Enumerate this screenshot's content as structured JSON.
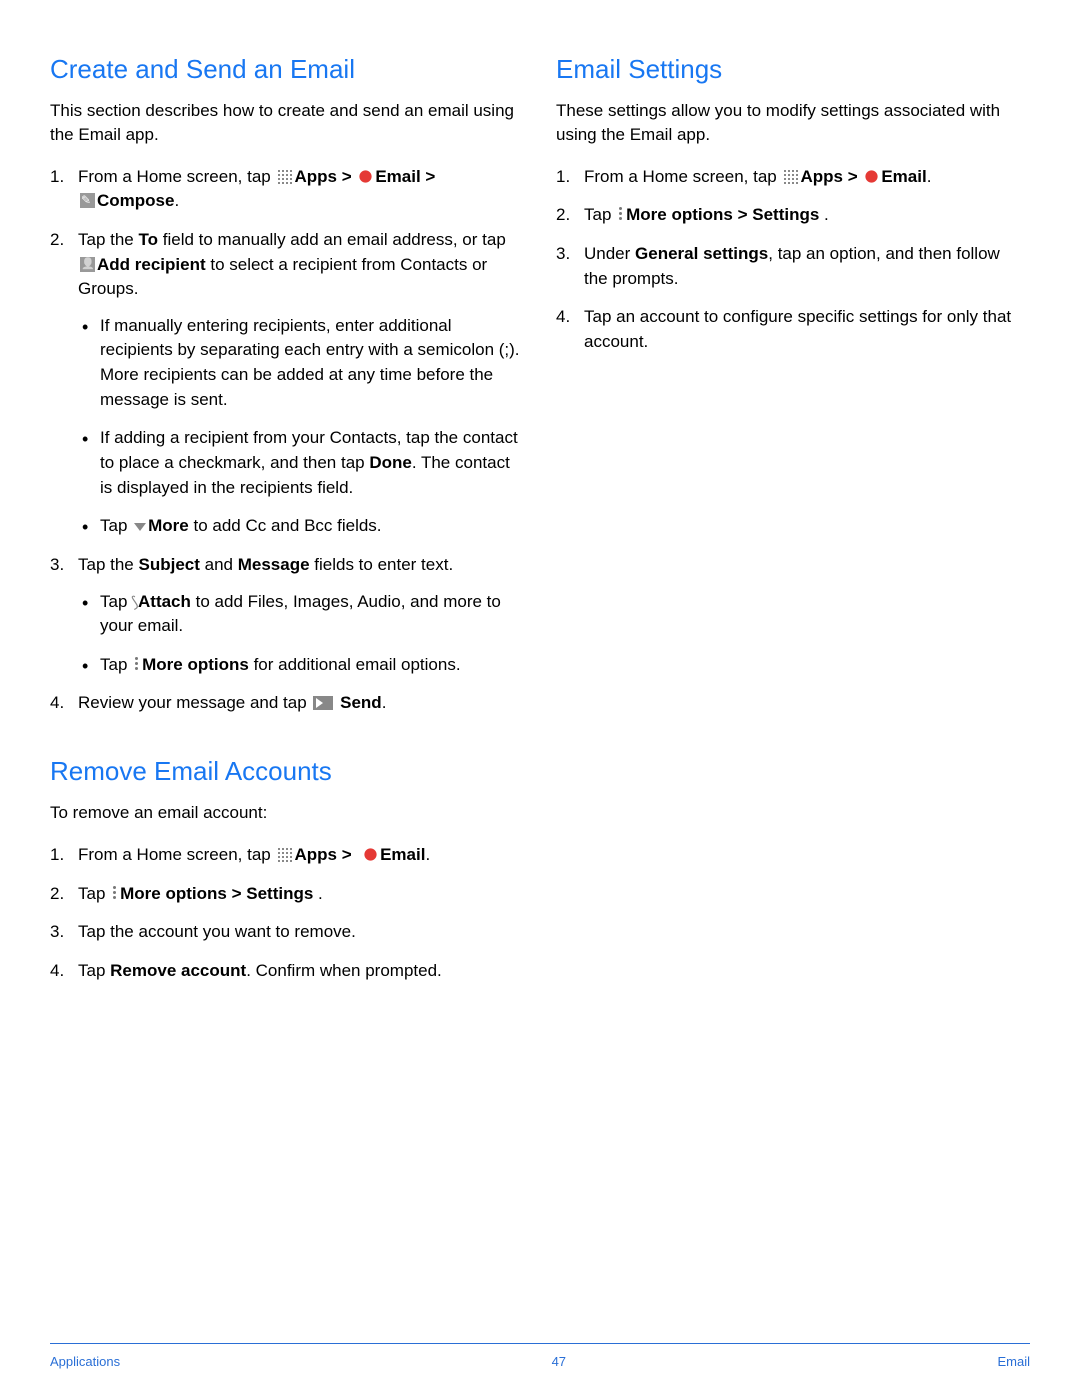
{
  "left": {
    "h1": "Create and Send an Email",
    "intro": "This section describes how to create and send an email using the Email app.",
    "s1_a": "From a Home screen, tap ",
    "apps": "Apps",
    "gt": " > ",
    "email": "Email",
    "compose": "Compose",
    "period": ".",
    "s2_a": "Tap the ",
    "to": "To",
    "s2_b": " field to manually add an email address, or tap ",
    "addrecipient": "Add recipient",
    "s2_c": " to select a recipient from Contacts or Groups.",
    "s2_bul1": "If manually entering recipients, enter additional recipients by separating each entry with a semicolon (;). More recipients can be added at any time before the message is sent.",
    "s2_bul2_a": "If adding a recipient from your Contacts, tap the contact to place a checkmark, and then tap ",
    "done": "Done",
    "s2_bul2_b": ". The contact is displayed in the recipients field.",
    "s2_bul3_a": "Tap ",
    "more": "More",
    "s2_bul3_b": " to add Cc and Bcc fields.",
    "s3_a": "Tap the ",
    "subject": "Subject",
    "and": " and ",
    "message": "Message",
    "s3_b": " fields to enter text.",
    "s3_bul1_a": "Tap ",
    "attach": "Attach",
    "s3_bul1_b": " to add Files, Images, Audio, and more to your email.",
    "s3_bul2_a": "Tap ",
    "moreoptions": "More options",
    "s3_bul2_b": " for additional email options.",
    "s4_a": "Review your message and tap ",
    "send": " Send",
    "h2": "Remove Email Accounts",
    "intro2": "To remove an email account:",
    "r1": "From a Home screen, tap ",
    "r2_a": "Tap ",
    "settings": "Settings",
    "settingsgt": " > ",
    "r2_b": " .",
    "r3": "Tap the account you want to remove.",
    "r4_a": "Tap ",
    "removeaccount": "Remove account",
    "r4_b": ". Confirm when prompted."
  },
  "right": {
    "h1": "Email Settings",
    "intro": "These settings allow you to modify settings associated with using the Email app.",
    "s1": "From a Home screen, tap ",
    "s2_a": "Tap ",
    "s2_b": " .",
    "s3_a": "Under ",
    "general": "General settings",
    "s3_b": ", tap an option, and then follow the prompts.",
    "s4": "Tap an account to configure specific settings for only that account."
  },
  "footer": {
    "left": "Applications",
    "center": "47",
    "right": "Email"
  }
}
